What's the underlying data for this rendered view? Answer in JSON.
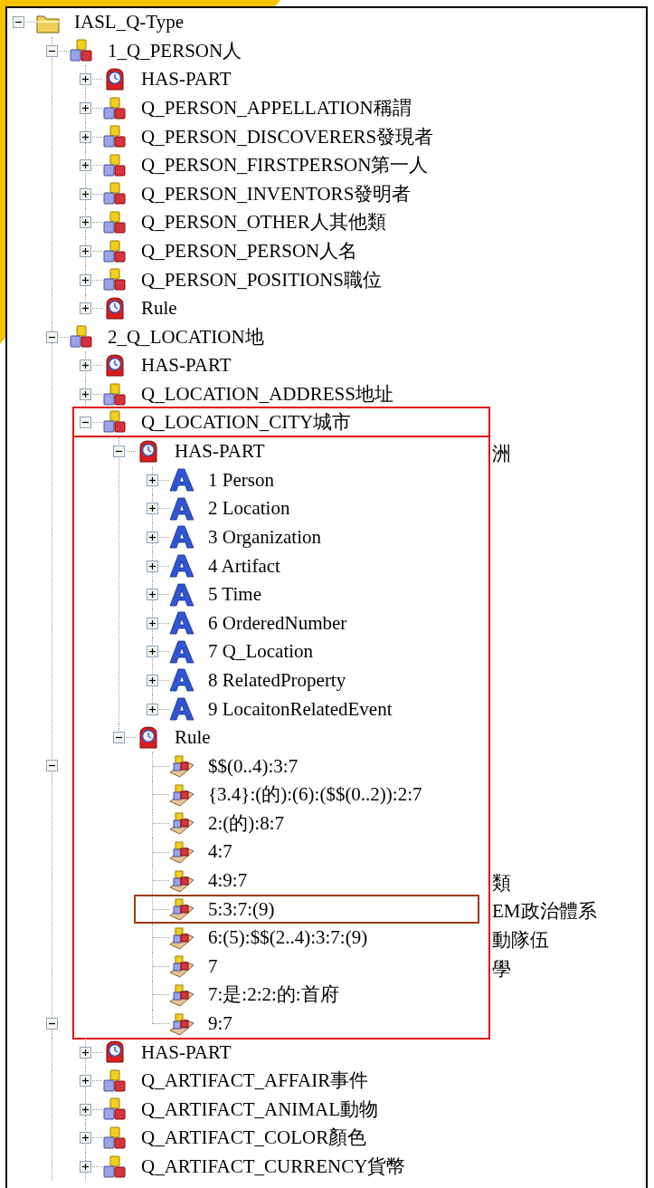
{
  "tree": {
    "label": "IASL_Q-Type",
    "kind": "folder",
    "expanded": true,
    "children": [
      {
        "label": "1_Q_PERSON人",
        "kind": "concept",
        "expanded": true,
        "children": [
          {
            "label": "HAS-PART",
            "kind": "relation",
            "expanded": false
          },
          {
            "label": "Q_PERSON_APPELLATION稱謂",
            "kind": "concept",
            "expanded": false
          },
          {
            "label": "Q_PERSON_DISCOVERERS發現者",
            "kind": "concept",
            "expanded": false
          },
          {
            "label": "Q_PERSON_FIRSTPERSON第一人",
            "kind": "concept",
            "expanded": false
          },
          {
            "label": "Q_PERSON_INVENTORS發明者",
            "kind": "concept",
            "expanded": false
          },
          {
            "label": "Q_PERSON_OTHER人其他類",
            "kind": "concept",
            "expanded": false
          },
          {
            "label": "Q_PERSON_PERSON人名",
            "kind": "concept",
            "expanded": false
          },
          {
            "label": "Q_PERSON_POSITIONS職位",
            "kind": "concept",
            "expanded": false
          },
          {
            "label": "Rule",
            "kind": "relation",
            "expanded": false
          }
        ]
      },
      {
        "label": "2_Q_LOCATION地",
        "kind": "concept",
        "expanded": true,
        "children": [
          {
            "label": "HAS-PART",
            "kind": "relation",
            "expanded": false
          },
          {
            "label": "Q_LOCATION_ADDRESS地址",
            "kind": "concept",
            "expanded": false
          },
          {
            "label": "Q_LOCATION_CITY城市",
            "kind": "concept",
            "expanded": true,
            "framed": true,
            "children": [
              {
                "label": "HAS-PART",
                "kind": "relation",
                "expanded": true,
                "behind_text": "洲",
                "children": [
                  {
                    "label": "1 Person",
                    "kind": "attribute",
                    "expanded": false
                  },
                  {
                    "label": "2 Location",
                    "kind": "attribute",
                    "expanded": false
                  },
                  {
                    "label": "3 Organization",
                    "kind": "attribute",
                    "expanded": false
                  },
                  {
                    "label": "4 Artifact",
                    "kind": "attribute",
                    "expanded": false
                  },
                  {
                    "label": "5 Time",
                    "kind": "attribute",
                    "expanded": false
                  },
                  {
                    "label": "6 OrderedNumber",
                    "kind": "attribute",
                    "expanded": false
                  },
                  {
                    "label": "7 Q_Location",
                    "kind": "attribute",
                    "expanded": false
                  },
                  {
                    "label": "8 RelatedProperty",
                    "kind": "attribute",
                    "expanded": false
                  },
                  {
                    "label": "9 LocaitonRelatedEvent",
                    "kind": "attribute",
                    "expanded": false
                  }
                ]
              },
              {
                "label": "Rule",
                "kind": "relation",
                "expanded": true,
                "children": [
                  {
                    "label": "$$(0..4):3:7",
                    "kind": "rule",
                    "behind_expander": {
                      "expanded": true
                    }
                  },
                  {
                    "label": "{3.4}:(的):(6):($$(0..2)):2:7",
                    "kind": "rule"
                  },
                  {
                    "label": "2:(的):8:7",
                    "kind": "rule"
                  },
                  {
                    "label": "4:7",
                    "kind": "rule"
                  },
                  {
                    "label": "4:9:7",
                    "kind": "rule",
                    "behind_text": "類"
                  },
                  {
                    "label": "5:3:7:(9)",
                    "kind": "rule",
                    "marked": true,
                    "behind_text": "EM政治體系"
                  },
                  {
                    "label": "6:(5):$$(2..4):3:7:(9)",
                    "kind": "rule",
                    "behind_text": "動隊伍"
                  },
                  {
                    "label": "7",
                    "kind": "rule",
                    "behind_text": "學"
                  },
                  {
                    "label": "7:是:2:2:的:首府",
                    "kind": "rule"
                  },
                  {
                    "label": "9:7",
                    "kind": "rule",
                    "behind_expander": {
                      "expanded": true
                    }
                  }
                ]
              }
            ]
          }
        ]
      }
    ]
  },
  "tail": [
    {
      "label": "HAS-PART",
      "kind": "relation",
      "expanded": false
    },
    {
      "label": "Q_ARTIFACT_AFFAIR事件",
      "kind": "concept",
      "expanded": false
    },
    {
      "label": "Q_ARTIFACT_ANIMAL動物",
      "kind": "concept",
      "expanded": false
    },
    {
      "label": "Q_ARTIFACT_COLOR顏色",
      "kind": "concept",
      "expanded": false
    },
    {
      "label": "Q_ARTIFACT_CURRENCY貨幣",
      "kind": "concept",
      "expanded": false
    }
  ]
}
